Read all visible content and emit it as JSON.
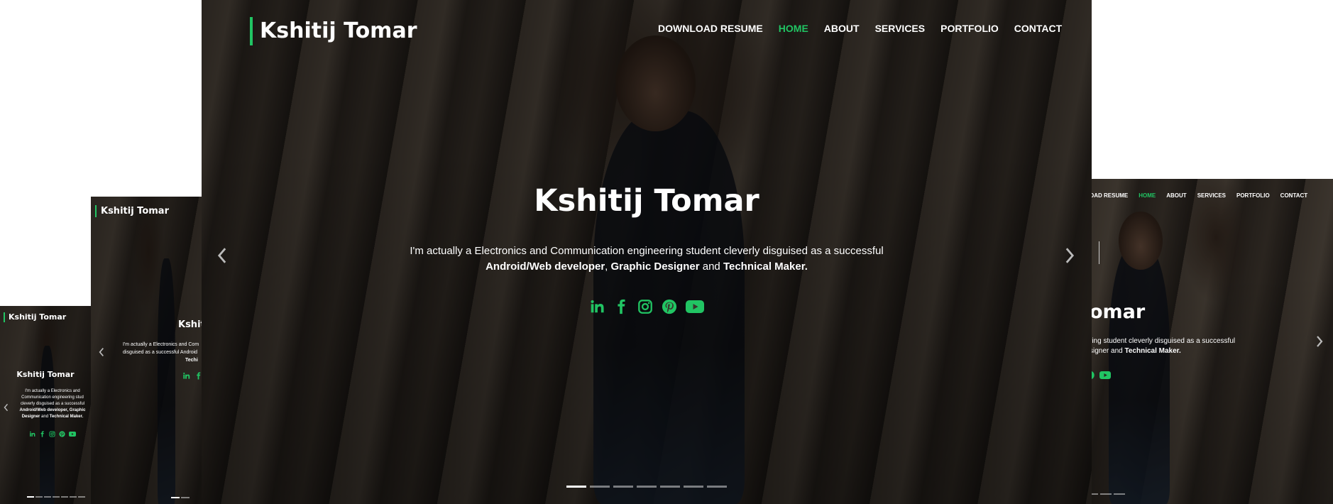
{
  "brand": {
    "name": "Kshitij Tomar",
    "accent": "#21c463"
  },
  "nav": {
    "items": [
      {
        "label": "DOWNLOAD RESUME",
        "active": false
      },
      {
        "label": "HOME",
        "active": true
      },
      {
        "label": "ABOUT",
        "active": false
      },
      {
        "label": "SERVICES",
        "active": false
      },
      {
        "label": "PORTFOLIO",
        "active": false
      },
      {
        "label": "CONTACT",
        "active": false
      }
    ],
    "right_partial_first_label": "OAD RESUME"
  },
  "hero": {
    "title": "Kshitij Tomar",
    "line1": "I'm actually a Electronics and Communication engineering student cleverly disguised as a successful",
    "bold1": "Android/Web developer",
    "sep1": ", ",
    "bold2": "Graphic Designer",
    "sep2": " and ",
    "bold3": "Technical Maker.",
    "small_line1": "I'm actually a Electronics and",
    "small_line2": "Communication engineering stud",
    "small_line3": "cleverly disguised as a successful",
    "small_line4_bold": "Android/Web developer",
    "small_line4_rest": ", Graphic",
    "small_line5_bold": "Designer",
    "small_line5_mid": " and ",
    "small_line5_bold2": "Technical Maker.",
    "med_title": "Kshit",
    "med_line1": "I'm actually a Electronics and Com",
    "med_line2": "disguised as a successful Android",
    "med_line3": "Techi",
    "right_title": "omar",
    "right_line1": "ring student cleverly disguised as a successful",
    "right_line2_pre": "signer and ",
    "right_line2_bold": "Technical Maker."
  },
  "socials": [
    {
      "icon": "linkedin-icon"
    },
    {
      "icon": "facebook-icon"
    },
    {
      "icon": "instagram-icon"
    },
    {
      "icon": "pinterest-icon"
    },
    {
      "icon": "youtube-icon"
    }
  ],
  "carousel": {
    "slides": 7,
    "active_slide": 1
  }
}
